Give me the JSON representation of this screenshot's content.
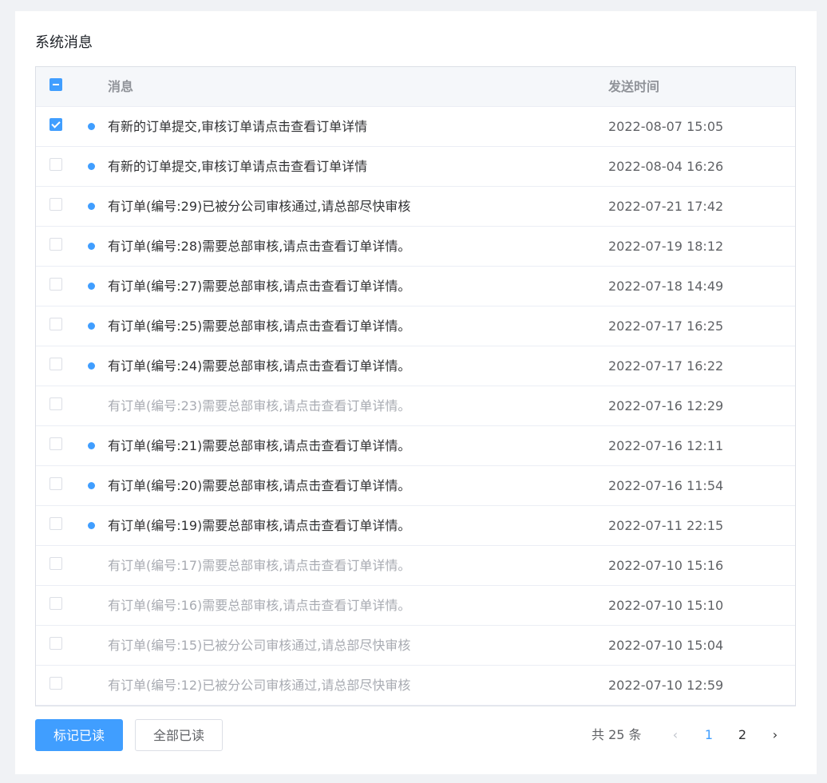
{
  "panel": {
    "title": "系统消息"
  },
  "table": {
    "columns": {
      "message": "消息",
      "sent_time": "发送时间"
    },
    "header_checkbox_state": "indeterminate",
    "rows": [
      {
        "message": "有新的订单提交,审核订单请点击查看订单详情",
        "time": "2022-08-07 15:05",
        "unread": true,
        "checked": true
      },
      {
        "message": "有新的订单提交,审核订单请点击查看订单详情",
        "time": "2022-08-04 16:26",
        "unread": true,
        "checked": false
      },
      {
        "message": "有订单(编号:29)已被分公司审核通过,请总部尽快审核",
        "time": "2022-07-21 17:42",
        "unread": true,
        "checked": false
      },
      {
        "message": "有订单(编号:28)需要总部审核,请点击查看订单详情。",
        "time": "2022-07-19 18:12",
        "unread": true,
        "checked": false
      },
      {
        "message": "有订单(编号:27)需要总部审核,请点击查看订单详情。",
        "time": "2022-07-18 14:49",
        "unread": true,
        "checked": false
      },
      {
        "message": "有订单(编号:25)需要总部审核,请点击查看订单详情。",
        "time": "2022-07-17 16:25",
        "unread": true,
        "checked": false
      },
      {
        "message": "有订单(编号:24)需要总部审核,请点击查看订单详情。",
        "time": "2022-07-17 16:22",
        "unread": true,
        "checked": false
      },
      {
        "message": "有订单(编号:23)需要总部审核,请点击查看订单详情。",
        "time": "2022-07-16 12:29",
        "unread": false,
        "checked": false
      },
      {
        "message": "有订单(编号:21)需要总部审核,请点击查看订单详情。",
        "time": "2022-07-16 12:11",
        "unread": true,
        "checked": false
      },
      {
        "message": "有订单(编号:20)需要总部审核,请点击查看订单详情。",
        "time": "2022-07-16 11:54",
        "unread": true,
        "checked": false
      },
      {
        "message": "有订单(编号:19)需要总部审核,请点击查看订单详情。",
        "time": "2022-07-11 22:15",
        "unread": true,
        "checked": false
      },
      {
        "message": "有订单(编号:17)需要总部审核,请点击查看订单详情。",
        "time": "2022-07-10 15:16",
        "unread": false,
        "checked": false
      },
      {
        "message": "有订单(编号:16)需要总部审核,请点击查看订单详情。",
        "time": "2022-07-10 15:10",
        "unread": false,
        "checked": false
      },
      {
        "message": "有订单(编号:15)已被分公司审核通过,请总部尽快审核",
        "time": "2022-07-10 15:04",
        "unread": false,
        "checked": false
      },
      {
        "message": "有订单(编号:12)已被分公司审核通过,请总部尽快审核",
        "time": "2022-07-10 12:59",
        "unread": false,
        "checked": false
      }
    ]
  },
  "actions": {
    "mark_read": "标记已读",
    "mark_all_read": "全部已读"
  },
  "pagination": {
    "total_text": "共 25 条",
    "prev_icon": "chevron-left-icon",
    "next_icon": "chevron-right-icon",
    "pages": [
      "1",
      "2"
    ],
    "current_page": "1"
  },
  "colors": {
    "primary": "#409eff",
    "unread_dot": "#409eff",
    "read_text": "#a8abb2",
    "page_background": "#f0f2f5"
  }
}
